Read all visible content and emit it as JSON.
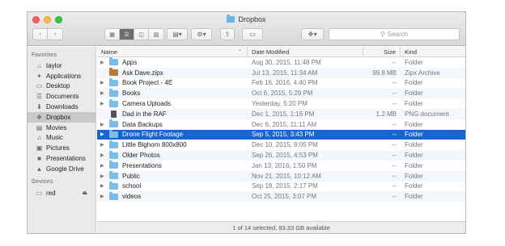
{
  "window": {
    "title": "Dropbox"
  },
  "toolbar": {
    "search_placeholder": "Search",
    "icon_color": "#6cb3e8"
  },
  "sidebar": {
    "favorites_header": "Favorites",
    "favorites": [
      {
        "label": "taylor",
        "icon": "home-icon"
      },
      {
        "label": "Applications",
        "icon": "applications-icon"
      },
      {
        "label": "Desktop",
        "icon": "desktop-icon"
      },
      {
        "label": "Documents",
        "icon": "documents-icon"
      },
      {
        "label": "Downloads",
        "icon": "downloads-icon"
      },
      {
        "label": "Dropbox",
        "icon": "dropbox-icon",
        "selected": true
      },
      {
        "label": "Movies",
        "icon": "movies-icon"
      },
      {
        "label": "Music",
        "icon": "music-icon"
      },
      {
        "label": "Pictures",
        "icon": "pictures-icon"
      },
      {
        "label": "Presentations",
        "icon": "folder-icon"
      },
      {
        "label": "Google Drive",
        "icon": "google-drive-icon"
      }
    ],
    "devices_header": "Devices",
    "devices": [
      {
        "label": "red",
        "icon": "disk-icon"
      }
    ]
  },
  "list": {
    "columns": {
      "name": "Name",
      "date": "Date Modified",
      "size": "Size",
      "kind": "Kind"
    },
    "rows": [
      {
        "name": "Apps",
        "date": "Aug 30, 2015, 11:48 PM",
        "size": "--",
        "kind": "Folder",
        "type": "folder"
      },
      {
        "name": "Ask Dave.zipx",
        "date": "Jul 13, 2015, 11:34 AM",
        "size": "99.8 MB",
        "kind": "Zipx Archive",
        "type": "zip"
      },
      {
        "name": "Book Project - 4E",
        "date": "Feb 16, 2016, 4:40 PM",
        "size": "--",
        "kind": "Folder",
        "type": "folder"
      },
      {
        "name": "Books",
        "date": "Oct 6, 2015, 5:29 PM",
        "size": "--",
        "kind": "Folder",
        "type": "folder"
      },
      {
        "name": "Camera Uploads",
        "date": "Yesterday, 5:20 PM",
        "size": "--",
        "kind": "Folder",
        "type": "folder"
      },
      {
        "name": "Dad in the RAF",
        "date": "Dec 1, 2015, 1:16 PM",
        "size": "1.2 MB",
        "kind": "PNG document",
        "type": "png"
      },
      {
        "name": "Data Backups",
        "date": "Dec 6, 2015, 11:11 AM",
        "size": "--",
        "kind": "Folder",
        "type": "folder"
      },
      {
        "name": "Drone Flight Footage",
        "date": "Sep 5, 2015, 3:43 PM",
        "size": "--",
        "kind": "Folder",
        "type": "folder",
        "selected": true
      },
      {
        "name": "Little Bighorn 800x800",
        "date": "Dec 10, 2015, 8:05 PM",
        "size": "--",
        "kind": "Folder",
        "type": "folder"
      },
      {
        "name": "Older Photos",
        "date": "Sep 26, 2015, 4:53 PM",
        "size": "--",
        "kind": "Folder",
        "type": "folder"
      },
      {
        "name": "Presentations",
        "date": "Jan 13, 2016, 1:50 PM",
        "size": "--",
        "kind": "Folder",
        "type": "folder"
      },
      {
        "name": "Public",
        "date": "Nov 21, 2015, 10:12 AM",
        "size": "--",
        "kind": "Folder",
        "type": "folder"
      },
      {
        "name": "school",
        "date": "Sep 18, 2015, 2:17 PM",
        "size": "--",
        "kind": "Folder",
        "type": "folder"
      },
      {
        "name": "videos",
        "date": "Oct 25, 2015, 3:07 PM",
        "size": "--",
        "kind": "Folder",
        "type": "folder"
      }
    ]
  },
  "status": {
    "text": "1 of 14 selected, 83.33 GB available"
  }
}
